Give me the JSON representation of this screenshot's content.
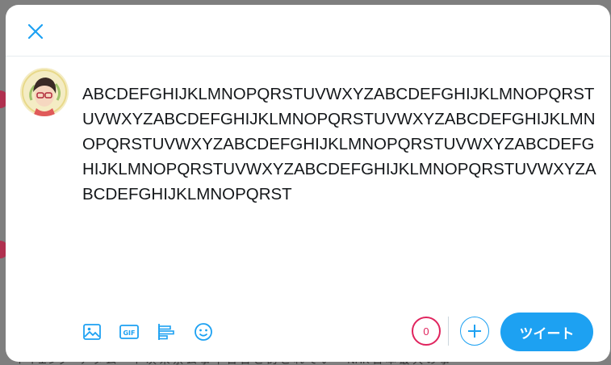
{
  "colors": {
    "accent": "#1da1f2",
    "counter_warning": "#e0245e",
    "text": "#14171a",
    "overlay": "#7f7f7f"
  },
  "background": {
    "snippet": "ドイェング・ナ タ ム 一 ト 次 米 京 ム 事 十 日 日 こ 的 こ れ て い ・ NHK 日 本 最 大 の 事"
  },
  "header": {
    "close_icon": "close-icon"
  },
  "compose": {
    "text": "ABCDEFGHIJKLMNOPQRSTUVWXYZABCDEFGHIJKLMNOPQRSTUVWXYZABCDEFGHIJKLMNOPQRSTUVWXYZABCDEFGHIJKLMNOPQRSTUVWXYZABCDEFGHIJKLMNOPQRSTUVWXYZABCDEFGHIJKLMNOPQRSTUVWXYZABCDEFGHIJKLMNOPQRSTUVWXYZABCDEFGHIJKLMNOPQRST",
    "avatar_icon": "avatar"
  },
  "toolbar": {
    "items": [
      {
        "icon": "image-icon"
      },
      {
        "icon": "gif-icon",
        "label": "GIF"
      },
      {
        "icon": "poll-icon"
      },
      {
        "icon": "emoji-icon"
      }
    ]
  },
  "footer": {
    "char_counter": "0",
    "add_icon": "plus-icon",
    "tweet_label": "ツイート"
  }
}
